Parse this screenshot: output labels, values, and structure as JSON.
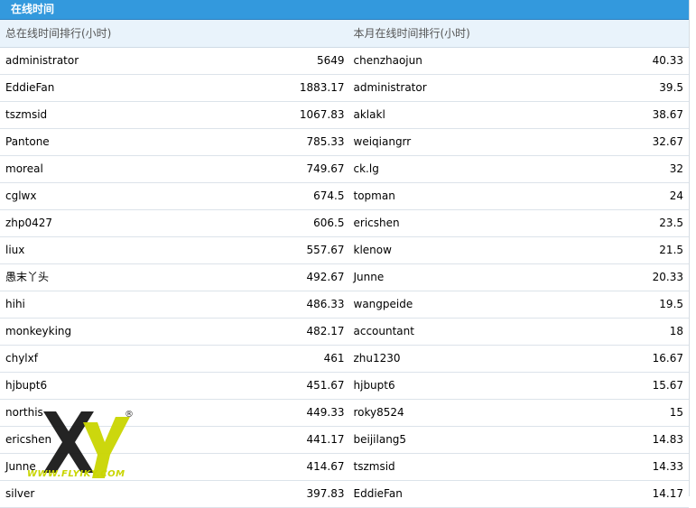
{
  "panel": {
    "title": "在线时间",
    "headers": {
      "left": "总在线时间排行(小时)",
      "right": "本月在线时间排行(小时)"
    }
  },
  "rows": [
    {
      "name_total": "administrator",
      "hours_total": "5649",
      "name_month": "chenzhaojun",
      "hours_month": "40.33"
    },
    {
      "name_total": "EddieFan",
      "hours_total": "1883.17",
      "name_month": "administrator",
      "hours_month": "39.5"
    },
    {
      "name_total": "tszmsid",
      "hours_total": "1067.83",
      "name_month": "aklakl",
      "hours_month": "38.67"
    },
    {
      "name_total": "Pantone",
      "hours_total": "785.33",
      "name_month": "weiqiangrr",
      "hours_month": "32.67"
    },
    {
      "name_total": "moreal",
      "hours_total": "749.67",
      "name_month": "ck.lg",
      "hours_month": "32"
    },
    {
      "name_total": "cglwx",
      "hours_total": "674.5",
      "name_month": "topman",
      "hours_month": "24"
    },
    {
      "name_total": "zhp0427",
      "hours_total": "606.5",
      "name_month": "ericshen",
      "hours_month": "23.5"
    },
    {
      "name_total": "liux",
      "hours_total": "557.67",
      "name_month": "klenow",
      "hours_month": "21.5"
    },
    {
      "name_total": "愚末丫头",
      "hours_total": "492.67",
      "name_month": "Junne",
      "hours_month": "20.33"
    },
    {
      "name_total": "hihi",
      "hours_total": "486.33",
      "name_month": "wangpeide",
      "hours_month": "19.5"
    },
    {
      "name_total": "monkeyking",
      "hours_total": "482.17",
      "name_month": "accountant",
      "hours_month": "18"
    },
    {
      "name_total": "chylxf",
      "hours_total": "461",
      "name_month": "zhu1230",
      "hours_month": "16.67"
    },
    {
      "name_total": "hjbupt6",
      "hours_total": "451.67",
      "name_month": "hjbupt6",
      "hours_month": "15.67"
    },
    {
      "name_total": "northis",
      "hours_total": "449.33",
      "name_month": "roky8524",
      "hours_month": "15"
    },
    {
      "name_total": "ericshen",
      "hours_total": "441.17",
      "name_month": "beijilang5",
      "hours_month": "14.83"
    },
    {
      "name_total": "Junne",
      "hours_total": "414.67",
      "name_month": "tszmsid",
      "hours_month": "14.33"
    },
    {
      "name_total": "silver",
      "hours_total": "397.83",
      "name_month": "EddieFan",
      "hours_month": "14.17"
    }
  ],
  "watermark": {
    "text": "WWW.FLYIKY.COM",
    "mark": "®",
    "color": "#c9d500",
    "dark": "#111111"
  }
}
